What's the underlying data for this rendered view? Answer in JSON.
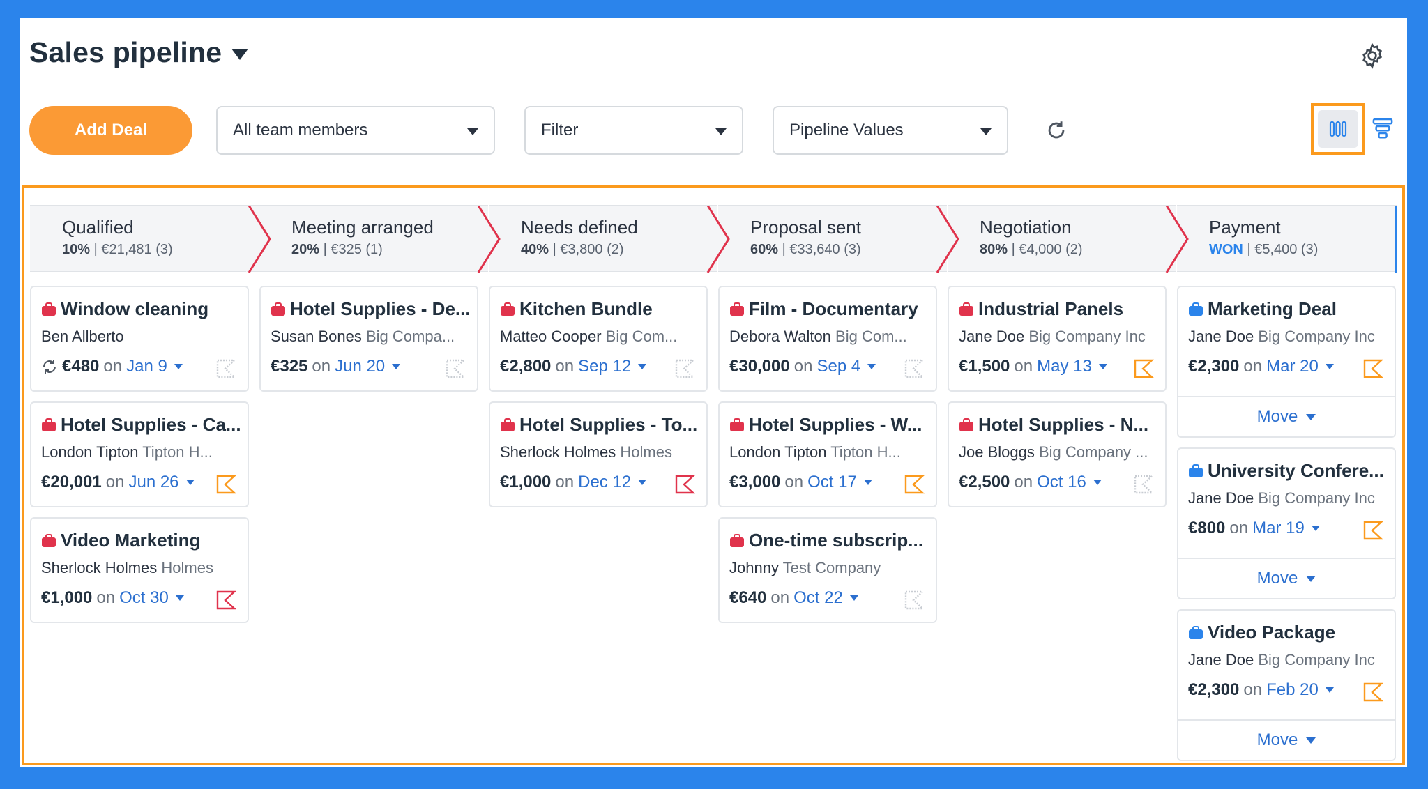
{
  "header": {
    "title": "Sales pipeline"
  },
  "toolbar": {
    "add_deal": "Add Deal",
    "team_select": "All team members",
    "filter_select": "Filter",
    "values_select": "Pipeline Values"
  },
  "colors": {
    "accent": "#2b84eb",
    "orange": "#fb9a35",
    "overdue": "#e0334c",
    "warn": "#fb9a1d",
    "neutral": "#c8ccd2"
  },
  "stages": [
    {
      "name": "Qualified",
      "pct": "10%",
      "sep": " | ",
      "summary": "€21,481 (3)"
    },
    {
      "name": "Meeting arranged",
      "pct": "20%",
      "sep": " | ",
      "summary": "€325 (1)"
    },
    {
      "name": "Needs defined",
      "pct": "40%",
      "sep": " | ",
      "summary": "€3,800 (2)"
    },
    {
      "name": "Proposal sent",
      "pct": "60%",
      "sep": " | ",
      "summary": "€33,640 (3)"
    },
    {
      "name": "Negotiation",
      "pct": "80%",
      "sep": " | ",
      "summary": "€4,000 (2)"
    },
    {
      "name": "Payment",
      "pct": "WON",
      "sep": " | ",
      "summary": "€5,400 (3)"
    }
  ],
  "columns": [
    [
      {
        "title": "Window cleaning",
        "person": "Ben Allberto",
        "company": "",
        "amount": "€480",
        "on": "on",
        "date": "Jan 9",
        "flag": "neutral",
        "sync": true
      },
      {
        "title": "Hotel Supplies - Ca...",
        "person": "London Tipton",
        "company": "Tipton H...",
        "amount": "€20,001",
        "on": "on",
        "date": "Jun 26",
        "flag": "warn"
      },
      {
        "title": "Video Marketing",
        "person": "Sherlock Holmes",
        "company": "Holmes",
        "amount": "€1,000",
        "on": "on",
        "date": "Oct 30",
        "flag": "overdue"
      }
    ],
    [
      {
        "title": "Hotel Supplies - De...",
        "person": "Susan Bones",
        "company": "Big Compa...",
        "amount": "€325",
        "on": "on",
        "date": "Jun 20",
        "flag": "neutral"
      }
    ],
    [
      {
        "title": "Kitchen Bundle",
        "person": "Matteo Cooper",
        "company": "Big Com...",
        "amount": "€2,800",
        "on": "on",
        "date": "Sep 12",
        "flag": "neutral"
      },
      {
        "title": "Hotel Supplies - To...",
        "person": "Sherlock Holmes",
        "company": "Holmes",
        "amount": "€1,000",
        "on": "on",
        "date": "Dec 12",
        "flag": "overdue"
      }
    ],
    [
      {
        "title": "Film - Documentary",
        "person": "Debora Walton",
        "company": "Big Com...",
        "amount": "€30,000",
        "on": "on",
        "date": "Sep 4",
        "flag": "neutral"
      },
      {
        "title": "Hotel Supplies - W...",
        "person": "London Tipton",
        "company": "Tipton H...",
        "amount": "€3,000",
        "on": "on",
        "date": "Oct 17",
        "flag": "warn"
      },
      {
        "title": "One-time subscrip...",
        "person": "Johnny",
        "company": "Test Company",
        "amount": "€640",
        "on": "on",
        "date": "Oct 22",
        "flag": "neutral"
      }
    ],
    [
      {
        "title": "Industrial Panels",
        "person": "Jane Doe",
        "company": "Big Company Inc",
        "amount": "€1,500",
        "on": "on",
        "date": "May 13",
        "flag": "warn"
      },
      {
        "title": "Hotel Supplies - N...",
        "person": "Joe Bloggs",
        "company": "Big Company ...",
        "amount": "€2,500",
        "on": "on",
        "date": "Oct 16",
        "flag": "neutral"
      }
    ],
    [
      {
        "title": "Marketing Deal",
        "person": "Jane Doe",
        "company": "Big Company Inc",
        "amount": "€2,300",
        "on": "on",
        "date": "Mar 20",
        "flag": "warn",
        "won": true,
        "move": "Move"
      },
      {
        "title": "University Confere...",
        "person": "Jane Doe",
        "company": "Big Company Inc",
        "amount": "€800",
        "on": "on",
        "date": "Mar 19",
        "flag": "warn",
        "won": true,
        "move": "Move"
      },
      {
        "title": "Video Package",
        "person": "Jane Doe",
        "company": "Big Company Inc",
        "amount": "€2,300",
        "on": "on",
        "date": "Feb 20",
        "flag": "warn",
        "won": true,
        "move": "Move"
      }
    ]
  ]
}
